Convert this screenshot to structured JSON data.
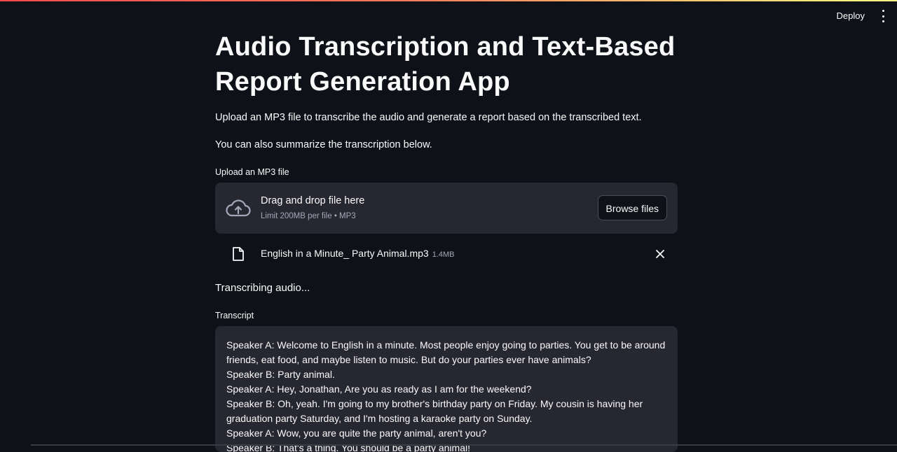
{
  "header": {
    "deploy_label": "Deploy",
    "menu_icon": "vertical-ellipsis-icon",
    "stripe_colors": [
      "#ff4b4b",
      "#fffd80"
    ]
  },
  "page": {
    "title": "Audio Transcription and Text-Based Report Generation App",
    "intro": "Upload an MP3 file to transcribe the audio and generate a report based on the transcribed text.",
    "intro2": "You can also summarize the transcription below."
  },
  "uploader": {
    "label": "Upload an MP3 file",
    "drop_title": "Drag and drop file here",
    "drop_sub": "Limit 200MB per file • MP3",
    "browse_label": "Browse files",
    "icon": "cloud-upload-icon"
  },
  "uploaded_file": {
    "name": "English in a Minute_ Party Animal.mp3",
    "size": "1.4MB",
    "icon": "file-icon",
    "remove_icon": "close-icon"
  },
  "status": {
    "text": "Transcribing audio..."
  },
  "transcript": {
    "label": "Transcript",
    "text": "Speaker A: Welcome to English in a minute. Most people enjoy going to parties. You get to be around friends, eat food, and maybe listen to music. But do your parties ever have animals?\nSpeaker B: Party animal.\nSpeaker A: Hey, Jonathan, Are you as ready as I am for the weekend?\nSpeaker B: Oh, yeah. I'm going to my brother's birthday party on Friday. My cousin is having her graduation party Saturday, and I'm hosting a karaoke party on Sunday.\nSpeaker A: Wow, you are quite the party animal, aren't you?\nSpeaker B: That's a thing. You should be a party animal!"
  },
  "colors": {
    "background": "#0e1117",
    "surface": "#262730",
    "text": "#fafafa",
    "muted": "#a3a8b8"
  }
}
